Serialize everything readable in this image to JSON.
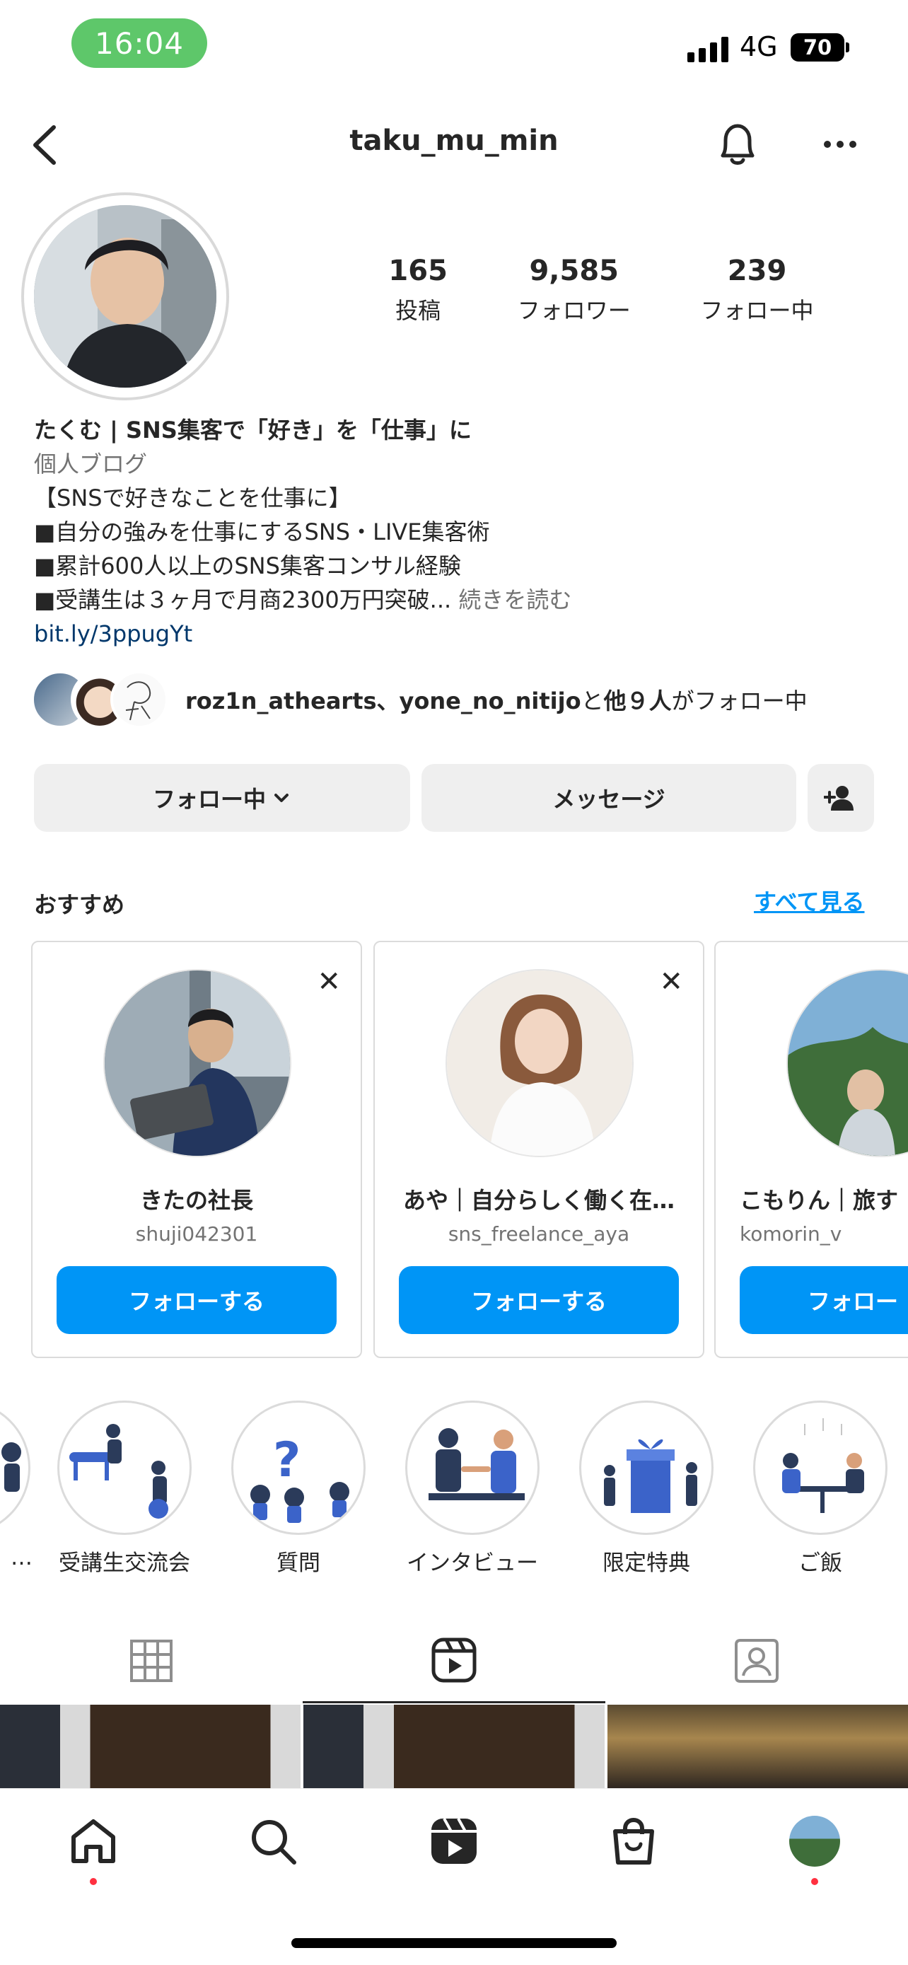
{
  "status_bar": {
    "time": "16:04",
    "network": "4G",
    "battery": "70"
  },
  "header": {
    "username": "taku_mu_min"
  },
  "stats": [
    {
      "num": "165",
      "label": "投稿"
    },
    {
      "num": "9,585",
      "label": "フォロワー"
    },
    {
      "num": "239",
      "label": "フォロー中"
    }
  ],
  "bio": {
    "name": "たくむ | SNS集客で「好き」を「仕事」に",
    "category": "個人ブログ",
    "lines": [
      "【SNSで好きなことを仕事に】",
      "■自分の強みを仕事にするSNS・LIVE集客術",
      "■累計600人以上のSNS集客コンサル経験",
      "■受講生は３ヶ月で月商2300万円突破..."
    ],
    "more": "続きを読む",
    "link": "bit.ly/3ppugYt"
  },
  "followed_by": {
    "users": "roz1n_athearts、yone_no_nitijo",
    "connector": "と",
    "others": "他９人",
    "suffix": "がフォロー中"
  },
  "actions": {
    "following": "フォロー中",
    "message": "メッセージ"
  },
  "suggestions": {
    "title": "おすすめ",
    "see_all": "すべて見る",
    "cards": [
      {
        "name": "きたの社長",
        "username": "shuji042301",
        "button": "フォローする"
      },
      {
        "name": "あや｜自分らしく働く在…",
        "username": "sns_freelance_aya",
        "button": "フォローする"
      },
      {
        "name": "こもりん｜旅す",
        "username": "komorin_v",
        "button": "フォロー"
      }
    ]
  },
  "highlights": [
    {
      "label": "…"
    },
    {
      "label": "受講生交流会"
    },
    {
      "label": "質問"
    },
    {
      "label": "インタビュー"
    },
    {
      "label": "限定特典"
    },
    {
      "label": "ご飯"
    }
  ],
  "icons": {
    "back": "chevron-left-icon",
    "bell": "bell-icon",
    "more": "more-horizontal-icon",
    "add_person": "add-person-icon",
    "close": "close-icon",
    "grid": "grid-icon",
    "reels": "reels-icon",
    "tagged": "tagged-icon",
    "home": "home-icon",
    "search": "search-icon",
    "shop": "shop-icon"
  },
  "colors": {
    "accent": "#0095f6",
    "link": "#00376b",
    "status_pill": "#5ec76a",
    "notification": "#ff3040"
  }
}
